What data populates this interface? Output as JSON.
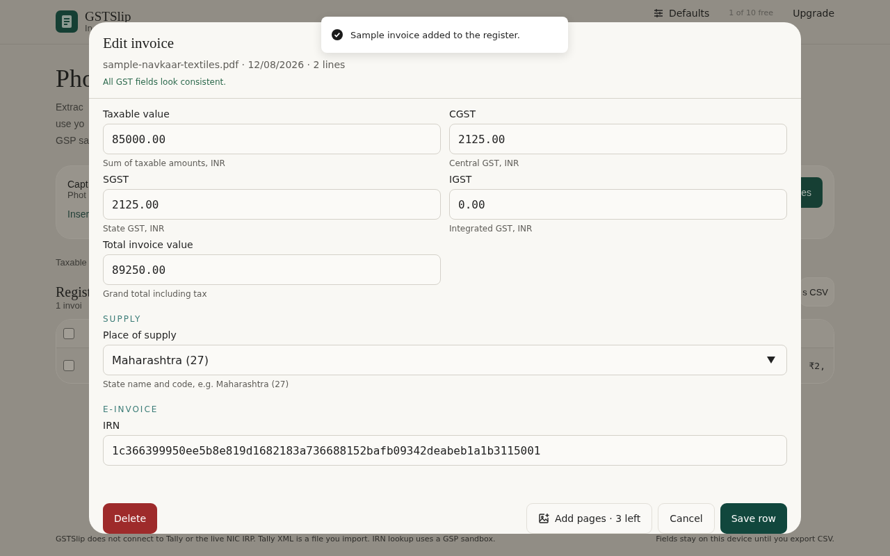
{
  "background": {
    "app_name": "GSTSlip",
    "app_subtitle": "In",
    "nav_link": "Defaults",
    "quota": "1 of 10 free",
    "upgrade": "Upgrade",
    "heading": "Pho",
    "intro_lines": [
      "Extrac",
      "use yo",
      "GSP sa"
    ],
    "capture_card": {
      "title": "Capt",
      "subtitle": "Phot",
      "link": "Inser",
      "button": "es"
    },
    "totals": "Taxable",
    "register": {
      "title": "Regist",
      "count": "1 invoi",
      "export_button": "s CSV",
      "header_checked": false,
      "rows": [
        {
          "checked": false,
          "amount": "₹2,"
        }
      ]
    }
  },
  "dialog": {
    "title": "Edit invoice",
    "meta": "sample-navkaar-textiles.pdf · 12/08/2026 · 2 lines",
    "status": "All GST fields look consistent.",
    "sections": [
      {
        "kind": "grid",
        "fields": [
          {
            "kind": "input",
            "label": "Taxable value",
            "value": "85000.00",
            "hint": "Sum of taxable amounts, INR"
          },
          {
            "kind": "input",
            "label": "CGST",
            "value": "2125.00",
            "hint": "Central GST, INR"
          },
          {
            "kind": "input",
            "label": "SGST",
            "value": "2125.00",
            "hint": "State GST, INR"
          },
          {
            "kind": "input",
            "label": "IGST",
            "value": "0.00",
            "hint": "Integrated GST, INR"
          },
          {
            "kind": "input",
            "label": "Total invoice value",
            "value": "89250.00",
            "hint": "Grand total including tax"
          }
        ]
      },
      {
        "kind": "stack",
        "heading": "SUPPLY",
        "fields": [
          {
            "kind": "select",
            "label": "Place of supply",
            "value": "Maharashtra (27)",
            "hint": "State name and code, e.g. Maharashtra (27)"
          }
        ]
      },
      {
        "kind": "stack",
        "heading": "E-INVOICE",
        "fields": [
          {
            "kind": "input",
            "label": "IRN",
            "value": "1c366399950ee5b8e819d1682183a736688152bafb09342deabeb1a1b3115001"
          }
        ]
      }
    ],
    "buttons": [
      {
        "kind": "danger",
        "label": "Delete"
      },
      {
        "kind": "add_pages",
        "label": "Add pages · 3 left"
      },
      {
        "kind": "plain",
        "label": "Cancel"
      },
      {
        "kind": "primary",
        "label": "Save row"
      }
    ]
  },
  "toast": {
    "message": "Sample invoice added to the register."
  },
  "footer": {
    "left": "GSTSlip does not connect to Tally or the live NIC IRP. Tally XML is a file you import. IRN lookup uses a GSP sandbox.",
    "right": "Fields stay on this device until you export CSV."
  }
}
